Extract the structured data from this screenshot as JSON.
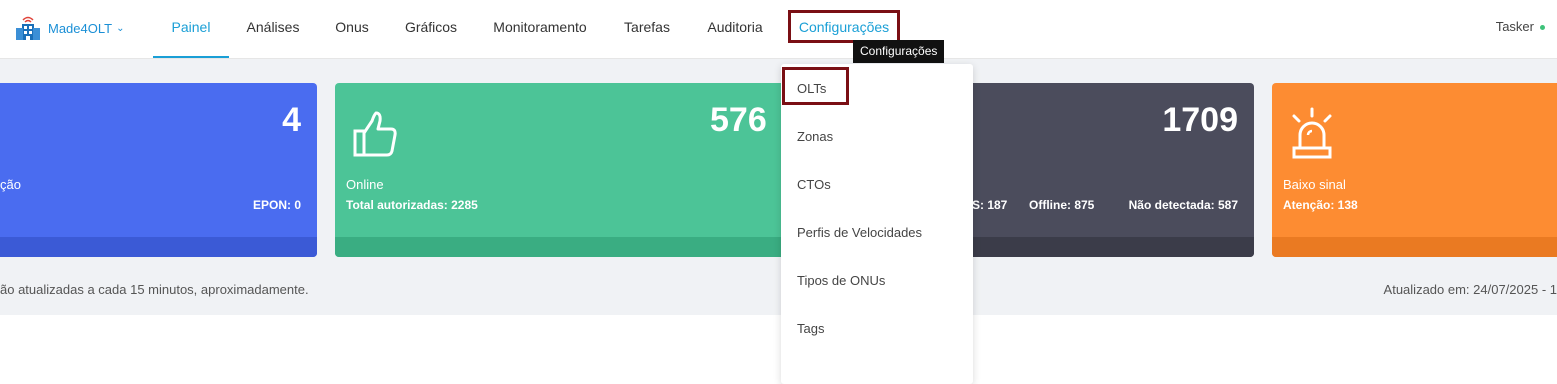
{
  "brand": {
    "name": "Made4OLT",
    "chevron": "chevron-down-icon"
  },
  "nav": {
    "items": [
      {
        "label": "Painel",
        "active": true
      },
      {
        "label": "Análises"
      },
      {
        "label": "Onus"
      },
      {
        "label": "Gráficos"
      },
      {
        "label": "Monitoramento"
      },
      {
        "label": "Tarefas"
      },
      {
        "label": "Auditoria"
      },
      {
        "label": "Configurações",
        "highlighted": true
      }
    ]
  },
  "user": {
    "name": "Tasker",
    "status_color": "#3ec27a"
  },
  "tooltip": {
    "text": "Configurações"
  },
  "dropdown": {
    "items": [
      {
        "label": "OLTs",
        "highlighted": true
      },
      {
        "label": "Zonas"
      },
      {
        "label": "CTOs"
      },
      {
        "label": "Perfis de Velocidades"
      },
      {
        "label": "Tipos de ONUs"
      },
      {
        "label": "Tags"
      }
    ]
  },
  "cards": {
    "blue": {
      "number": "4",
      "label": "ção",
      "sub": "EPON: 0",
      "color": "#4a6cf0"
    },
    "green": {
      "number": "576",
      "label": "Online",
      "sub": "Total autorizadas: 2285",
      "icon": "thumbs-up-icon",
      "color": "#4cc497"
    },
    "dark": {
      "number": "1709",
      "sub_a": "S: 187",
      "sub_b": "Offline: 875",
      "sub_c": "Não detectada: 587",
      "color": "#4b4c5c"
    },
    "orange": {
      "label": "Baixo sinal",
      "sub": "Atenção: 138",
      "icon": "alarm-siren-icon",
      "color": "#fd8c32"
    }
  },
  "info": {
    "left": "ão atualizadas a cada 15 minutos, aproximadamente.",
    "right": "Atualizado em: 24/07/2025 - 1"
  }
}
